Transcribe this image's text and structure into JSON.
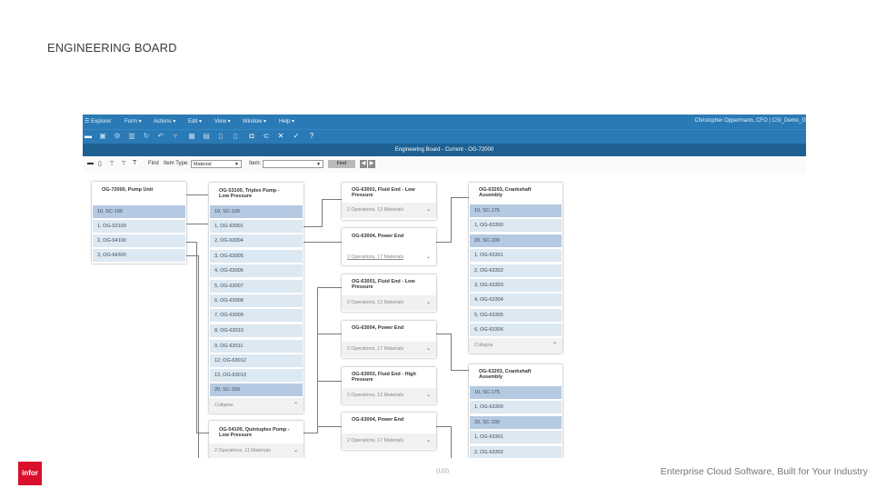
{
  "slide_title": "ENGINEERING BOARD",
  "menubar": {
    "items": [
      "Explorer",
      "Form ▾",
      "Actions ▾",
      "Edit ▾",
      "View ▾",
      "Window ▾",
      "Help ▾"
    ],
    "user": "Christopher Oppermann, CFO | CSI_Demo_G"
  },
  "tab_title": "Engineering Board - Current - OG-72000",
  "find_bar": {
    "find_label": "Find",
    "item_type_label": "Item Type:",
    "item_type_value": "Material",
    "item_label": "Item:",
    "item_value": "",
    "find_button": "Find"
  },
  "cards": [
    {
      "title": [
        "OG-72000, Pump Unit"
      ],
      "rows": [
        {
          "t": "10, SC-100",
          "hl": true
        },
        {
          "t": "1, OG-63100",
          "hl": false
        },
        {
          "t": "2, OG-64100",
          "hl": false
        },
        {
          "t": "3, OG-64300",
          "hl": false
        }
      ]
    },
    {
      "title": [
        "OG-53100, Triplex Pump -",
        "Low Pressure"
      ],
      "rows": [
        {
          "t": "10, SC-100",
          "hl": true
        },
        {
          "t": "1, OG-63001",
          "hl": false
        },
        {
          "t": "2, OG-63004",
          "hl": false
        },
        {
          "t": "3, OG-63005",
          "hl": false
        },
        {
          "t": "4, OG-63006",
          "hl": false
        },
        {
          "t": "5, OG-63007",
          "hl": false
        },
        {
          "t": "6, OG-63008",
          "hl": false
        },
        {
          "t": "7, OG-63009",
          "hl": false
        },
        {
          "t": "8, OG-63010",
          "hl": false
        },
        {
          "t": "9, OG-63011",
          "hl": false
        },
        {
          "t": "12, OG-63012",
          "hl": false
        },
        {
          "t": "13, OG-63013",
          "hl": false
        },
        {
          "t": "20, SC-150",
          "hl": true
        }
      ],
      "foot": "Collapse",
      "chev": "⌃"
    },
    {
      "title": [
        "OG-54100, Quintuplex Pump -",
        "Low Pressure"
      ],
      "rows": [],
      "foot": "2 Operations, 11 Materials",
      "chev": "⌄"
    },
    {
      "title": [
        "OG-63001, Fluid End - Low",
        "Pressure"
      ],
      "rows": [],
      "foot": "2 Operations, 13 Materials",
      "chev": "⌄"
    },
    {
      "title": [
        "OG-63004, Power End"
      ],
      "rows": [],
      "foot": "2 Operations, 17 Materials",
      "chev": "⌄",
      "uline": true
    },
    {
      "title": [
        "OG-63001, Fluid End - Low",
        "Pressure"
      ],
      "rows": [],
      "foot": "2 Operations, 13 Materials",
      "chev": "⌄"
    },
    {
      "title": [
        "OG-63004, Power End"
      ],
      "rows": [],
      "foot": "2 Operations, 17 Materials",
      "chev": "⌄"
    },
    {
      "title": [
        "OG-63003, Fluid End - High",
        "Pressure"
      ],
      "rows": [],
      "foot": "2 Operations, 13 Materials",
      "chev": "⌄"
    },
    {
      "title": [
        "OG-63004, Power End"
      ],
      "rows": [],
      "foot": "2 Operations, 17 Materials",
      "chev": "⌄"
    },
    {
      "title": [
        "OG-63203, Crankshaft",
        "Assembly"
      ],
      "rows": [
        {
          "t": "10, SC-175",
          "hl": true
        },
        {
          "t": "1, OG-63300",
          "hl": false
        },
        {
          "t": "20, SC-100",
          "hl": true
        },
        {
          "t": "1, OG-63301",
          "hl": false
        },
        {
          "t": "2, OG-63302",
          "hl": false
        },
        {
          "t": "3, OG-63303",
          "hl": false
        },
        {
          "t": "4, OG-63304",
          "hl": false
        },
        {
          "t": "5, OG-63305",
          "hl": false
        },
        {
          "t": "6, OG-63306",
          "hl": false
        }
      ],
      "foot": "Collapse",
      "chev": "⌃"
    },
    {
      "title": [
        "OG-63203, Crankshaft",
        "Assembly"
      ],
      "rows": [
        {
          "t": "10, SC-175",
          "hl": true
        },
        {
          "t": "1, OG-63300",
          "hl": false
        },
        {
          "t": "20, SC-100",
          "hl": true
        },
        {
          "t": "1, OG-63301",
          "hl": false
        },
        {
          "t": "2, OG-63302",
          "hl": false
        }
      ]
    }
  ],
  "footer": {
    "page": "(122)",
    "tagline": "Enterprise Cloud Software, Built for Your Industry",
    "logo": "infor"
  },
  "colors": {
    "menubar": "#2a7ab5",
    "tab_header": "#1e6091",
    "row": "#dce8f2",
    "row_highlight": "#b5c9e2",
    "logo": "#d8102c"
  }
}
